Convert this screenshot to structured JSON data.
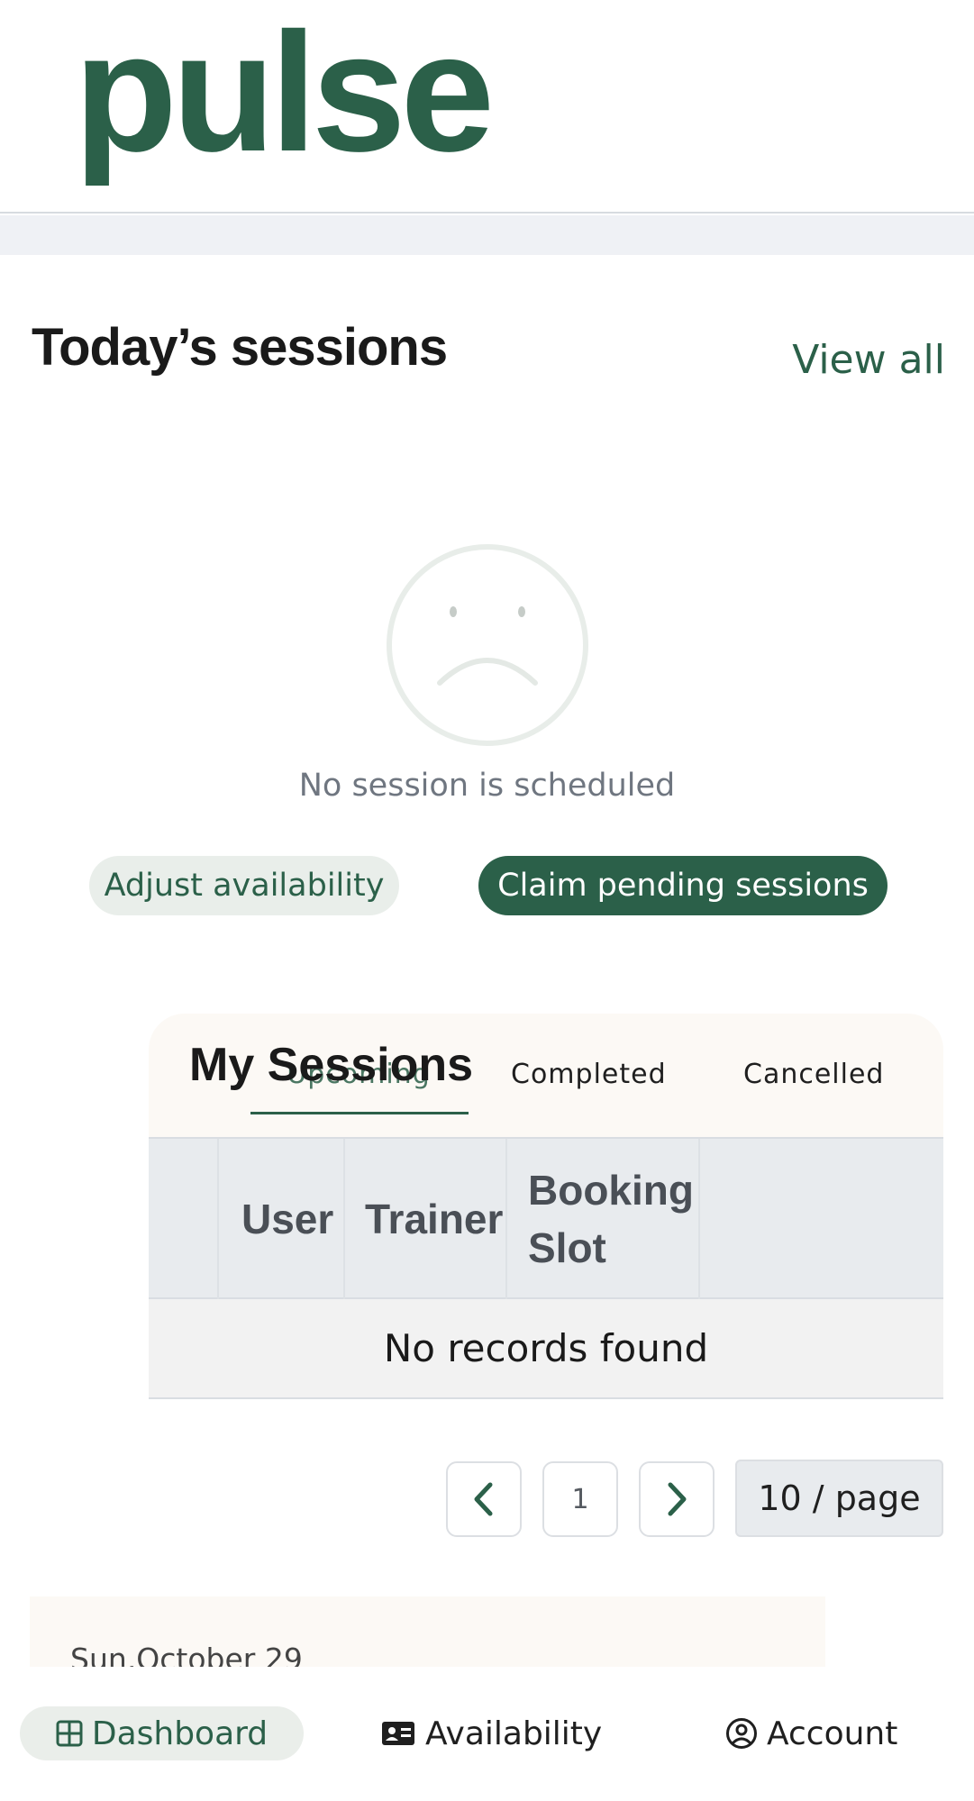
{
  "brand": {
    "logo_text": "pulse",
    "primary_color": "#2b6049"
  },
  "today": {
    "title": "Today’s sessions",
    "view_all": "View all",
    "empty_icon": "sad-face-icon",
    "empty_text": "No session is scheduled",
    "adjust_button": "Adjust availability",
    "claim_button": "Claim pending sessions"
  },
  "my_sessions": {
    "title": "My Sessions",
    "tabs": [
      {
        "label": "Upcoming",
        "active": true
      },
      {
        "label": "Completed",
        "active": false
      },
      {
        "label": "Cancelled",
        "active": false
      }
    ],
    "columns": [
      "User",
      "Trainer",
      "Booking Slot"
    ],
    "empty_text": "No records found",
    "pagination": {
      "current_page": "1",
      "page_size": "10 / page"
    }
  },
  "day_card": {
    "date_label": "Sun,October 29"
  },
  "bottom_nav": {
    "items": [
      {
        "label": "Dashboard",
        "icon": "grid-icon",
        "active": true
      },
      {
        "label": "Availability",
        "icon": "id-card-icon",
        "active": false
      },
      {
        "label": "Account",
        "icon": "user-circle-icon",
        "active": false
      }
    ]
  }
}
